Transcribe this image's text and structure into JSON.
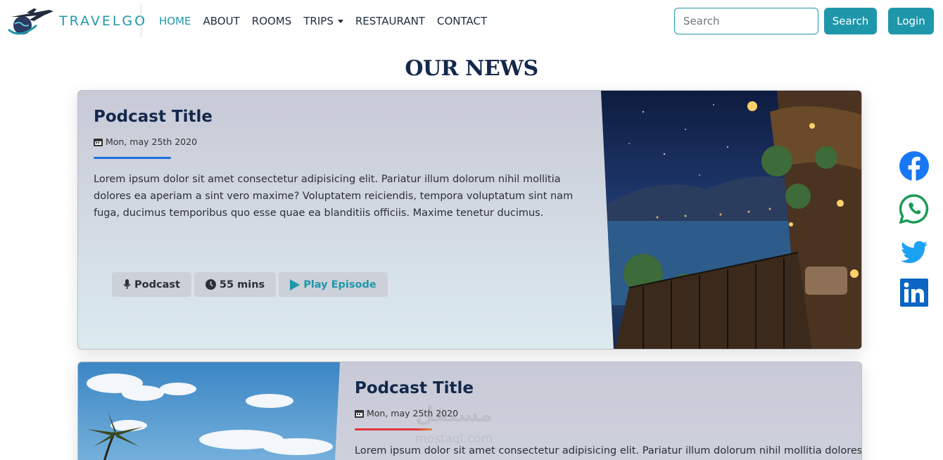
{
  "brand": {
    "name": "TRAVELGO",
    "logo_icon": "airplane-globe-logo"
  },
  "nav": {
    "items": [
      {
        "label": "HOME",
        "active": true
      },
      {
        "label": "ABOUT"
      },
      {
        "label": "ROOMS"
      },
      {
        "label": "TRIPS"
      },
      {
        "label": "RESTAURANT"
      },
      {
        "label": "CONTACT"
      }
    ]
  },
  "search": {
    "placeholder": "Search",
    "button_label": "Search"
  },
  "login": {
    "label": "Login"
  },
  "colors": {
    "accent": "#1f97aa",
    "heading": "#13284b",
    "underline_blue": "#1d6fe0",
    "underline_red": "#e0343c",
    "underline_orange": "#e08a3a"
  },
  "section": {
    "title": "OUR NEWS"
  },
  "cards": [
    {
      "title": "Podcast Title",
      "date": "Mon, may 25th 2020",
      "body": "Lorem ipsum dolor sit amet consectetur adipisicing elit. Pariatur illum dolorum nihil mollitia dolores ea aperiam a sint vero maxime? Voluptatem reiciendis, tempora voluptatum sint nam fuga, ducimus temporibus quo esse quae ea blanditiis officiis. Maxime tenetur ducimus.",
      "tags": {
        "podcast": "Podcast",
        "duration": "55 mins",
        "play": "Play Episode"
      }
    },
    {
      "title": "Podcast Title",
      "date": "Mon, may 25th 2020",
      "body": "Lorem ipsum dolor sit amet consectetur adipisicing elit. Pariatur illum dolorum nihil mollitia dolores"
    }
  ],
  "social": [
    "facebook-icon",
    "whatsapp-icon",
    "twitter-icon",
    "linkedin-icon"
  ],
  "watermark": {
    "text": "مستقل",
    "sub": "mostaql.com"
  }
}
